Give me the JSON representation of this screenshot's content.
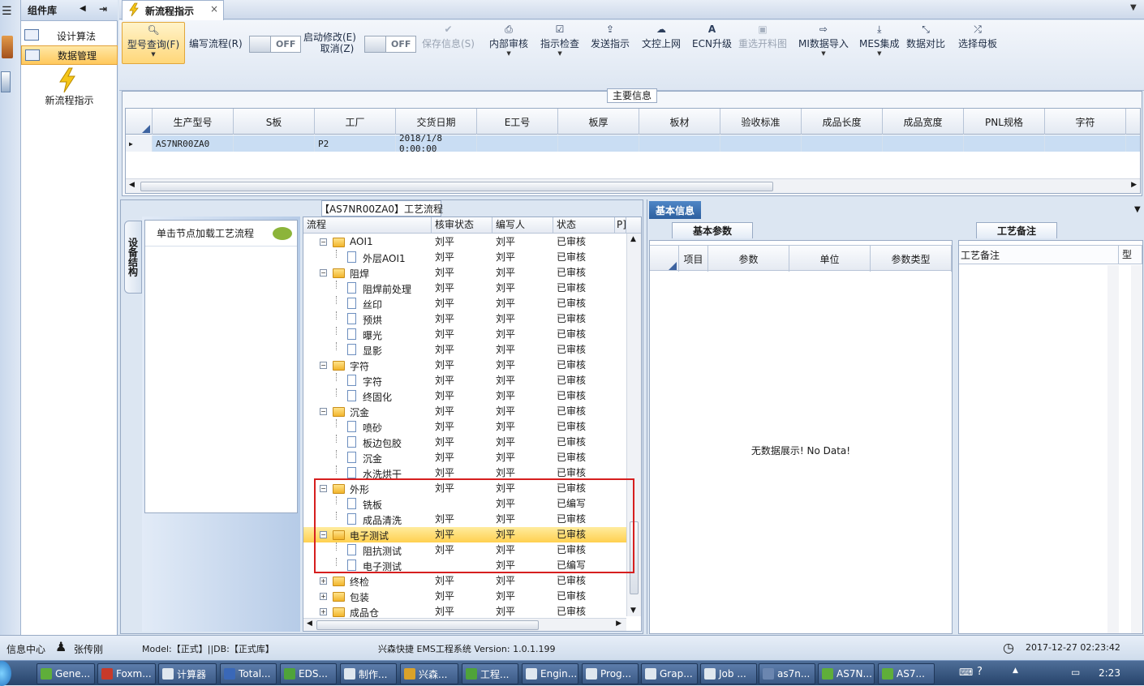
{
  "sidebar": {
    "title": "组件库",
    "items": [
      {
        "label": "设计算法"
      },
      {
        "label": "数据管理"
      }
    ],
    "new_flow_label": "新流程指示"
  },
  "tabs": [
    {
      "label": "新流程指示",
      "close": "×"
    }
  ],
  "toolbar": {
    "buttons": [
      {
        "label": "型号查询(F)",
        "icon": "search-icon"
      },
      {
        "label": "编写流程(R)"
      },
      {
        "label": "启动修改(E)"
      },
      {
        "label": "取消(Z)"
      },
      {
        "label": "保存信息(S)",
        "icon": "check-icon",
        "disabled": true
      },
      {
        "label": "内部审核",
        "icon": "print-icon"
      },
      {
        "label": "指示检查",
        "icon": "checkbox-icon"
      },
      {
        "label": "发送指示",
        "icon": "upload-icon"
      },
      {
        "label": "文控上网",
        "icon": "cloud-upload-icon"
      },
      {
        "label": "ECN升级",
        "icon": "font-icon"
      },
      {
        "label": "重选开料图",
        "icon": "image-icon",
        "disabled": true
      },
      {
        "label": "MI数据导入",
        "icon": "sign-in-icon"
      },
      {
        "label": "MES集成",
        "icon": "download-icon"
      },
      {
        "label": "数据对比",
        "icon": "compress-icon"
      },
      {
        "label": "选择母板",
        "icon": "shuffle-icon"
      }
    ],
    "toggle_off": "OFF"
  },
  "main_info": {
    "title": "主要信息",
    "columns": [
      "生产型号",
      "S板",
      "工厂",
      "交货日期",
      "E工号",
      "板厚",
      "板材",
      "验收标准",
      "成品长度",
      "成品宽度",
      "PNL规格",
      "字符"
    ],
    "rows": [
      [
        "AS7NR00ZA0",
        "",
        "P2",
        "2018/1/8 0:00:00",
        "",
        "",
        "",
        "",
        "",
        "",
        "",
        ""
      ]
    ]
  },
  "process": {
    "title": "【AS7NR00ZA0】工艺流程",
    "side_tab": "设备结构",
    "device_hint": "单击节点加载工艺流程",
    "columns": [
      "流程",
      "核审状态",
      "编写人",
      "状态",
      "P]"
    ],
    "rows": [
      {
        "name": "AOI1",
        "level": 0,
        "reviewer": "刘平",
        "writer": "刘平",
        "status": "已审核"
      },
      {
        "name": "外层AOI1",
        "level": 1,
        "reviewer": "刘平",
        "writer": "刘平",
        "status": "已审核"
      },
      {
        "name": "阻焊",
        "level": 0,
        "reviewer": "刘平",
        "writer": "刘平",
        "status": "已审核"
      },
      {
        "name": "阻焊前处理",
        "level": 1,
        "reviewer": "刘平",
        "writer": "刘平",
        "status": "已审核"
      },
      {
        "name": "丝印",
        "level": 1,
        "reviewer": "刘平",
        "writer": "刘平",
        "status": "已审核"
      },
      {
        "name": "预烘",
        "level": 1,
        "reviewer": "刘平",
        "writer": "刘平",
        "status": "已审核"
      },
      {
        "name": "曝光",
        "level": 1,
        "reviewer": "刘平",
        "writer": "刘平",
        "status": "已审核"
      },
      {
        "name": "显影",
        "level": 1,
        "reviewer": "刘平",
        "writer": "刘平",
        "status": "已审核"
      },
      {
        "name": "字符",
        "level": 0,
        "reviewer": "刘平",
        "writer": "刘平",
        "status": "已审核"
      },
      {
        "name": "字符",
        "level": 1,
        "reviewer": "刘平",
        "writer": "刘平",
        "status": "已审核"
      },
      {
        "name": "终固化",
        "level": 1,
        "reviewer": "刘平",
        "writer": "刘平",
        "status": "已审核"
      },
      {
        "name": "沉金",
        "level": 0,
        "reviewer": "刘平",
        "writer": "刘平",
        "status": "已审核"
      },
      {
        "name": "喷砂",
        "level": 1,
        "reviewer": "刘平",
        "writer": "刘平",
        "status": "已审核"
      },
      {
        "name": "板边包胶",
        "level": 1,
        "reviewer": "刘平",
        "writer": "刘平",
        "status": "已审核"
      },
      {
        "name": "沉金",
        "level": 1,
        "reviewer": "刘平",
        "writer": "刘平",
        "status": "已审核"
      },
      {
        "name": "水洗烘干",
        "level": 1,
        "reviewer": "刘平",
        "writer": "刘平",
        "status": "已审核"
      },
      {
        "name": "外形",
        "level": 0,
        "reviewer": "刘平",
        "writer": "刘平",
        "status": "已审核"
      },
      {
        "name": "铣板",
        "level": 1,
        "reviewer": "",
        "writer": "刘平",
        "status": "已编写"
      },
      {
        "name": "成品清洗",
        "level": 1,
        "reviewer": "刘平",
        "writer": "刘平",
        "status": "已审核"
      },
      {
        "name": "电子测试",
        "level": 0,
        "reviewer": "刘平",
        "writer": "刘平",
        "status": "已审核",
        "selected": true
      },
      {
        "name": "阻抗测试",
        "level": 1,
        "reviewer": "刘平",
        "writer": "刘平",
        "status": "已审核"
      },
      {
        "name": "电子测试",
        "level": 1,
        "reviewer": "",
        "writer": "刘平",
        "status": "已编写"
      },
      {
        "name": "终检",
        "level": 0,
        "collapsed": true,
        "reviewer": "刘平",
        "writer": "刘平",
        "status": "已审核"
      },
      {
        "name": "包装",
        "level": 0,
        "collapsed": true,
        "reviewer": "刘平",
        "writer": "刘平",
        "status": "已审核"
      },
      {
        "name": "成品仓",
        "level": 0,
        "collapsed": true,
        "reviewer": "刘平",
        "writer": "刘平",
        "status": "已审核"
      }
    ]
  },
  "basic_info": {
    "title": "基本信息",
    "param_tab": "基本参数",
    "param_columns": [
      "项目",
      "参数",
      "单位",
      "参数类型"
    ],
    "no_data": "无数据展示! No Data!",
    "note_tab": "工艺备注",
    "note_column": "工艺备注",
    "note_col2": "型"
  },
  "status_bar": {
    "info_center": "信息中心",
    "user": "张传刚",
    "model": "Model:【正式】||DB:【正式库】",
    "system": "兴森快捷 EMS工程系统 Version: 1.0.1.199",
    "datetime": "2017-12-27 02:23:42"
  },
  "taskbar": {
    "tasks": [
      "Gene...",
      "Foxm...",
      "计算器",
      "Total...",
      "EDS...",
      "制作...",
      "兴森...",
      "工程...",
      "Engin...",
      "Prog...",
      "Grap...",
      "Job ...",
      "as7n...",
      "AS7N...",
      "AS7..."
    ],
    "time": "2:23"
  }
}
